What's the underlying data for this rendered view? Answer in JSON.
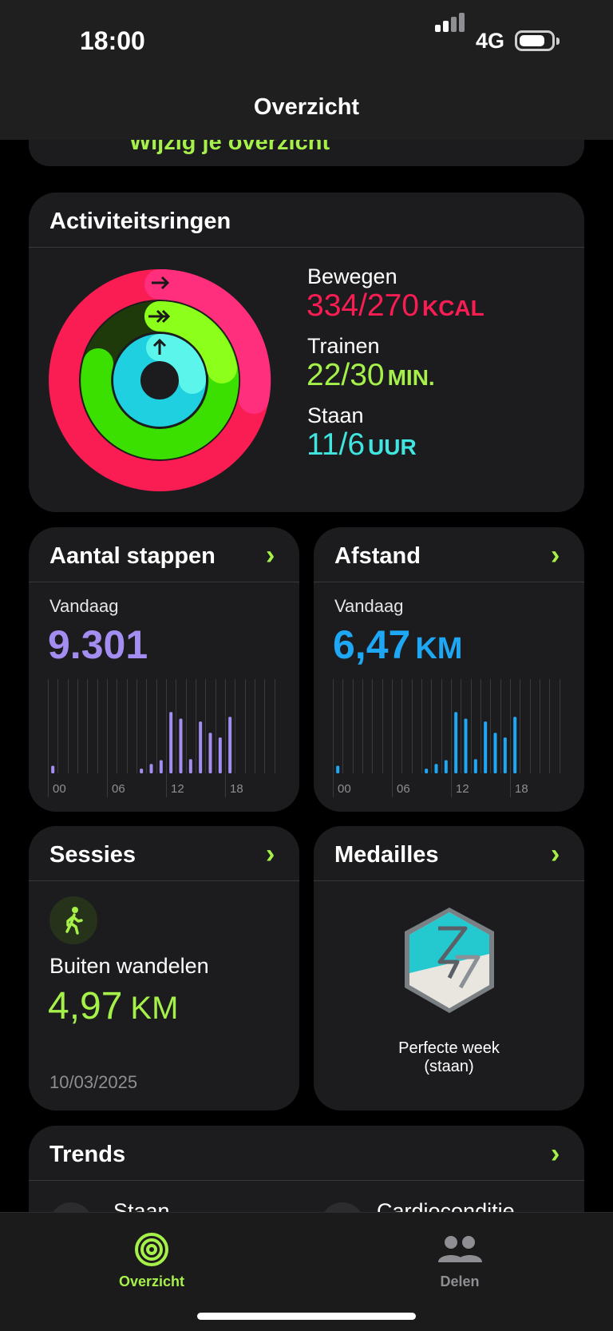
{
  "status_bar": {
    "time": "18:00",
    "network": "4G"
  },
  "nav": {
    "title": "Overzicht"
  },
  "edit_summary": {
    "label": "Wijzig je overzicht"
  },
  "activity_rings": {
    "title": "Activiteitsringen",
    "move": {
      "label": "Bewegen",
      "value": "334/270",
      "unit": "KCAL",
      "color": "#ff2d55",
      "progress": 1.237
    },
    "exercise": {
      "label": "Trainen",
      "value": "22/30",
      "unit": "MIN.",
      "color": "#a6f04a",
      "progress": 0.733
    },
    "stand": {
      "label": "Staan",
      "value": "11/6",
      "unit": "UUR",
      "color": "#40e5e0",
      "progress": 1.833
    }
  },
  "steps": {
    "title": "Aantal stappen",
    "today_label": "Vandaag",
    "value": "9.301",
    "color": "#a48df1",
    "axis_labels": [
      "00",
      "06",
      "12",
      "18"
    ],
    "hourly": [
      0.08,
      0,
      0,
      0,
      0,
      0,
      0,
      0,
      0,
      0.05,
      0.1,
      0.14,
      0.65,
      0.58,
      0.15,
      0.55,
      0.43,
      0.38,
      0.6,
      0,
      0,
      0,
      0,
      0
    ]
  },
  "distance": {
    "title": "Afstand",
    "today_label": "Vandaag",
    "value": "6,47",
    "unit": "KM",
    "color": "#1ea7f5",
    "axis_labels": [
      "00",
      "06",
      "12",
      "18"
    ],
    "hourly": [
      0.08,
      0,
      0,
      0,
      0,
      0,
      0,
      0,
      0,
      0.05,
      0.1,
      0.14,
      0.65,
      0.58,
      0.15,
      0.55,
      0.43,
      0.38,
      0.6,
      0,
      0,
      0,
      0,
      0
    ]
  },
  "sessions": {
    "title": "Sessies",
    "workout": "Buiten wandelen",
    "value": "4,97",
    "unit": "KM",
    "date": "10/03/2025"
  },
  "medals": {
    "title": "Medailles",
    "award_line1": "Perfecte week",
    "award_line2": "(staan)"
  },
  "trends": {
    "title": "Trends",
    "item1": "Staan",
    "item2": "Cardioconditie"
  },
  "tabs": [
    {
      "label": "Overzicht",
      "active": true
    },
    {
      "label": "Delen",
      "active": false
    }
  ]
}
